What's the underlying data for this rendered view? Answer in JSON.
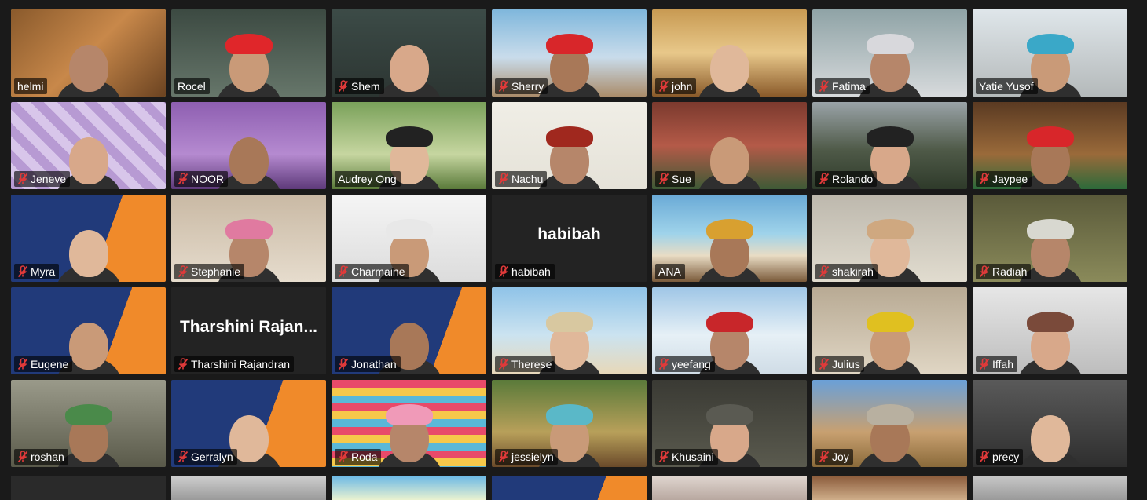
{
  "colors": {
    "active_border": "#c6e35c",
    "muted_icon": "#e03a3a",
    "label_bg": "rgba(0,0,0,0.62)"
  },
  "participants": [
    {
      "name": "helmi",
      "muted": false,
      "active": true
    },
    {
      "name": "Rocel",
      "muted": false
    },
    {
      "name": "Shem",
      "muted": true
    },
    {
      "name": "Sherry",
      "muted": true
    },
    {
      "name": "john",
      "muted": true
    },
    {
      "name": "Fatima",
      "muted": true
    },
    {
      "name": "Yatie Yusof",
      "muted": false
    },
    {
      "name": "Jeneve",
      "muted": true
    },
    {
      "name": "NOOR",
      "muted": true
    },
    {
      "name": "Audrey Ong",
      "muted": false
    },
    {
      "name": "Nachu",
      "muted": true
    },
    {
      "name": "Sue",
      "muted": true
    },
    {
      "name": "Rolando",
      "muted": true
    },
    {
      "name": "Jaypee",
      "muted": true
    },
    {
      "name": "Myra",
      "muted": true
    },
    {
      "name": "Stephanie",
      "muted": true
    },
    {
      "name": "Charmaine",
      "muted": true
    },
    {
      "name": "habibah",
      "muted": true,
      "video_off": true,
      "display_name": "habibah"
    },
    {
      "name": "ANA",
      "muted": false
    },
    {
      "name": "shakirah",
      "muted": true
    },
    {
      "name": "Radiah",
      "muted": true
    },
    {
      "name": "Eugene",
      "muted": true
    },
    {
      "name": "Tharshini Rajandran",
      "muted": true,
      "video_off": true,
      "display_name": "Tharshini  Rajan..."
    },
    {
      "name": "Jonathan",
      "muted": true
    },
    {
      "name": "Therese",
      "muted": true
    },
    {
      "name": "yeefang",
      "muted": true
    },
    {
      "name": "Julius",
      "muted": true
    },
    {
      "name": "Iffah",
      "muted": true
    },
    {
      "name": "roshan",
      "muted": true
    },
    {
      "name": "Gerralyn",
      "muted": true
    },
    {
      "name": "Roda",
      "muted": true
    },
    {
      "name": "jessielyn",
      "muted": true
    },
    {
      "name": "Khusaini",
      "muted": true
    },
    {
      "name": "Joy",
      "muted": true
    },
    {
      "name": "precy",
      "muted": true
    }
  ]
}
